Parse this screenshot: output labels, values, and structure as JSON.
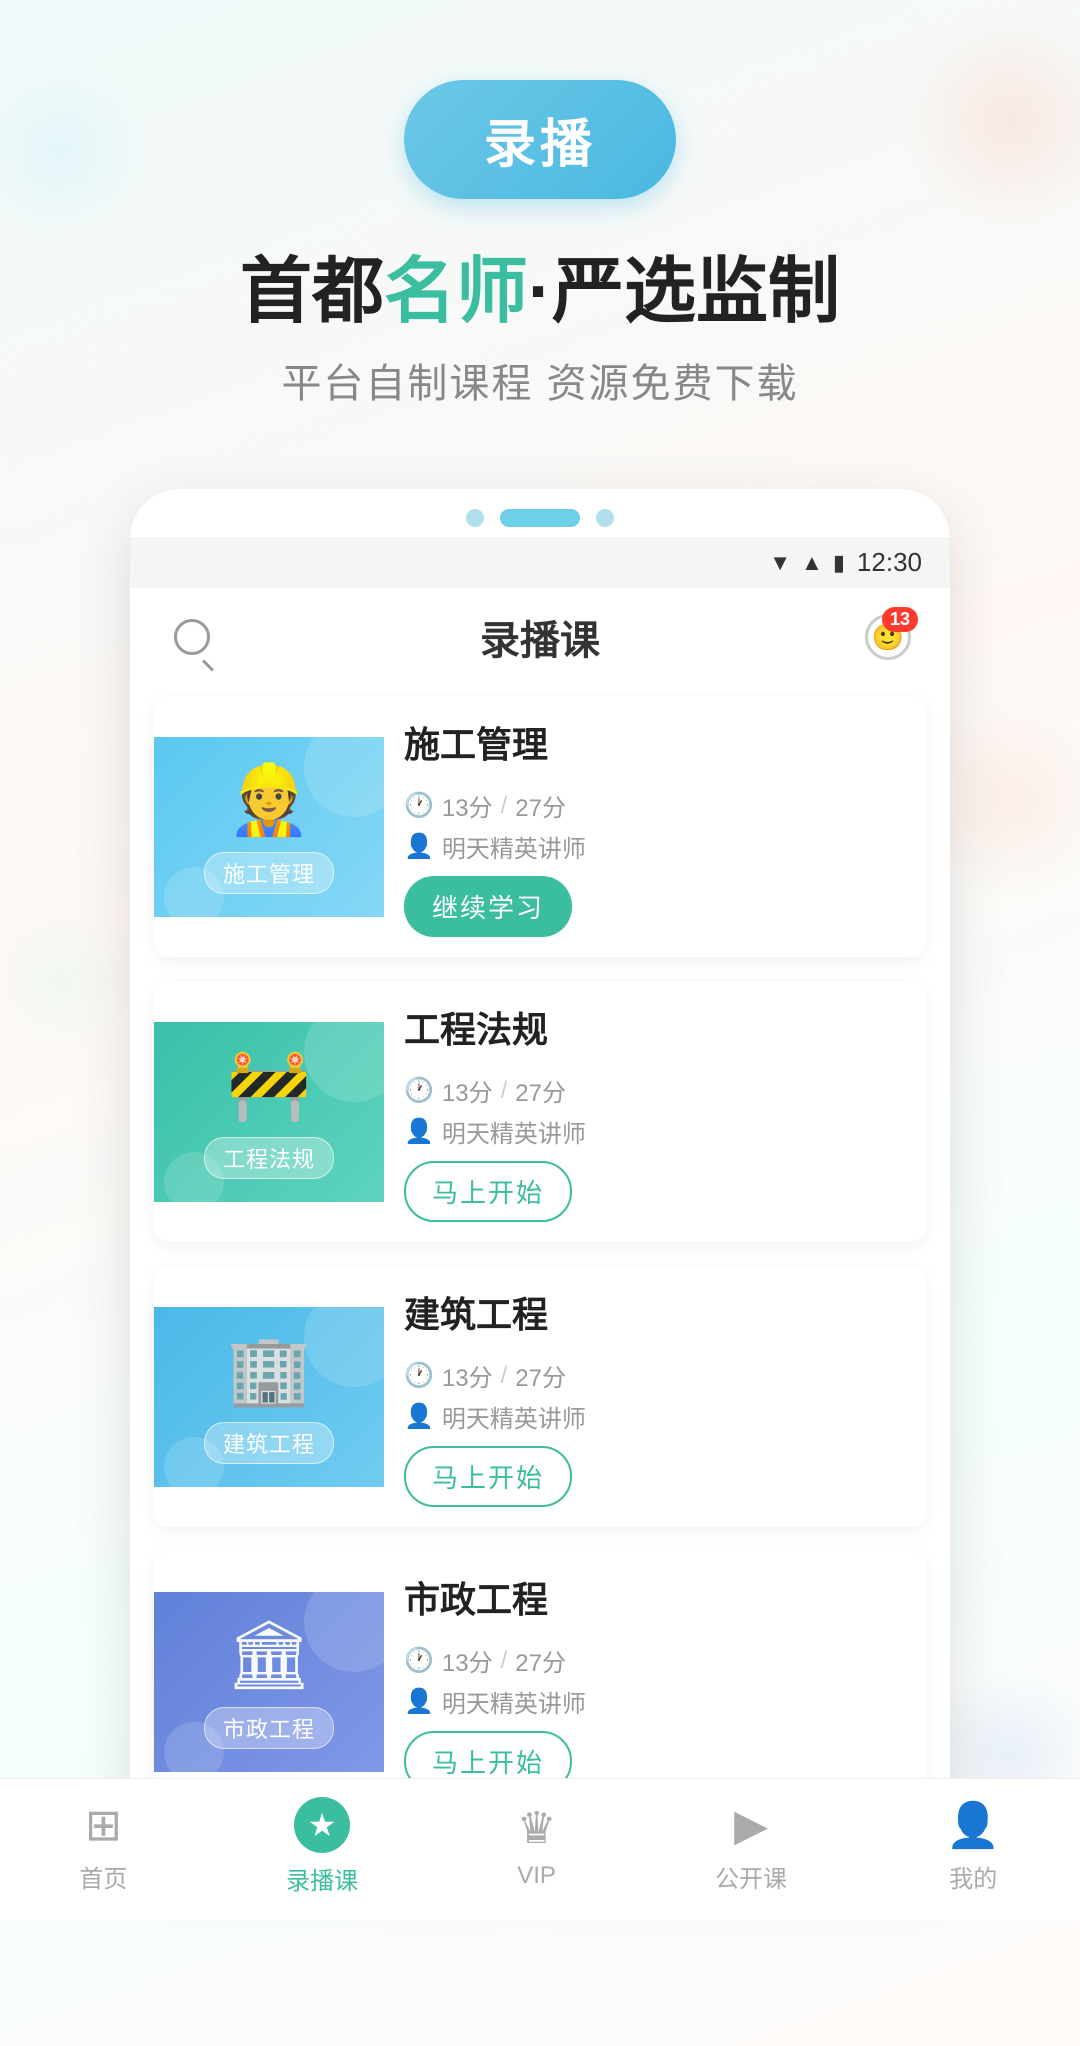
{
  "header": {
    "button_label": "录播",
    "tagline_part1": "首都",
    "tagline_highlight": "名师",
    "tagline_part2": "·严选监制",
    "subtitle": "平台自制课程 资源免费下载"
  },
  "phone": {
    "status_bar": {
      "time": "12:30"
    },
    "top_bar": {
      "title": "录播课",
      "badge": "13"
    },
    "pagination": {
      "dots": 3,
      "active_index": 1
    }
  },
  "courses": [
    {
      "id": 1,
      "name": "施工管理",
      "thumb_label": "施工管理",
      "icon": "👷",
      "time": "13分",
      "total": "27分",
      "teacher": "明天精英讲师",
      "action": "continue",
      "action_label": "继续学习",
      "color_class": "course-thumb-1"
    },
    {
      "id": 2,
      "name": "工程法规",
      "thumb_label": "工程法规",
      "icon": "🚧",
      "time": "13分",
      "total": "27分",
      "teacher": "明天精英讲师",
      "action": "start",
      "action_label": "马上开始",
      "color_class": "course-thumb-2"
    },
    {
      "id": 3,
      "name": "建筑工程",
      "thumb_label": "建筑工程",
      "icon": "🏢",
      "time": "13分",
      "total": "27分",
      "teacher": "明天精英讲师",
      "action": "start",
      "action_label": "马上开始",
      "color_class": "course-thumb-3"
    },
    {
      "id": 4,
      "name": "市政工程",
      "thumb_label": "市政工程",
      "icon": "🏛",
      "time": "13分",
      "total": "27分",
      "teacher": "明天精英讲师",
      "action": "start",
      "action_label": "马上开始",
      "color_class": "course-thumb-4"
    }
  ],
  "bottom_nav": {
    "items": [
      {
        "id": "home",
        "label": "首页",
        "icon": "⊞",
        "active": false
      },
      {
        "id": "lübo",
        "label": "录播课",
        "icon": "★",
        "active": true
      },
      {
        "id": "vip",
        "label": "VIP",
        "icon": "👑",
        "active": false
      },
      {
        "id": "gonkai",
        "label": "公开课",
        "icon": "📹",
        "active": false
      },
      {
        "id": "mine",
        "label": "我的",
        "icon": "👤",
        "active": false
      }
    ]
  },
  "colors": {
    "accent": "#3bbda0",
    "blue": "#4ab8e0",
    "red": "#ff3b30"
  }
}
